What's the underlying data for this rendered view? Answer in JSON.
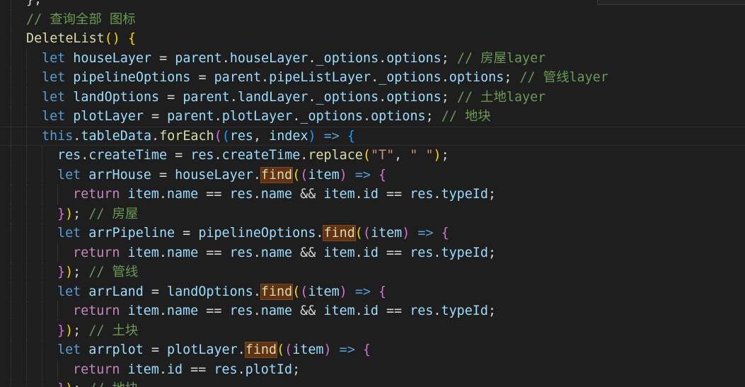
{
  "editor": {
    "language": "javascript",
    "theme": "dark",
    "lines": [
      {
        "indent": 1,
        "tokens": [
          [
            "pun",
            "};"
          ]
        ]
      },
      {
        "indent": 1,
        "tokens": [
          [
            "cm",
            "// 查询全部 图标"
          ]
        ]
      },
      {
        "indent": 1,
        "tokens": [
          [
            "fn",
            "DeleteList"
          ],
          [
            "b1",
            "()"
          ],
          [
            "pun",
            " "
          ],
          [
            "b1",
            "{"
          ]
        ]
      },
      {
        "indent": 2,
        "tokens": [
          [
            "kw",
            "let"
          ],
          [
            "pun",
            " "
          ],
          [
            "var",
            "houseLayer"
          ],
          [
            "pun",
            " = "
          ],
          [
            "var",
            "parent"
          ],
          [
            "pun",
            "."
          ],
          [
            "var",
            "houseLayer"
          ],
          [
            "pun",
            "."
          ],
          [
            "var",
            "_options"
          ],
          [
            "pun",
            "."
          ],
          [
            "var",
            "options"
          ],
          [
            "pun",
            "; "
          ],
          [
            "cm",
            "// 房屋layer"
          ]
        ]
      },
      {
        "indent": 2,
        "tokens": [
          [
            "kw",
            "let"
          ],
          [
            "pun",
            " "
          ],
          [
            "var",
            "pipelineOptions"
          ],
          [
            "pun",
            " = "
          ],
          [
            "var",
            "parent"
          ],
          [
            "pun",
            "."
          ],
          [
            "var",
            "pipeListLayer"
          ],
          [
            "pun",
            "."
          ],
          [
            "var",
            "_options"
          ],
          [
            "pun",
            "."
          ],
          [
            "var",
            "options"
          ],
          [
            "pun",
            "; "
          ],
          [
            "cm",
            "// 管线layer"
          ]
        ]
      },
      {
        "indent": 2,
        "tokens": [
          [
            "kw",
            "let"
          ],
          [
            "pun",
            " "
          ],
          [
            "var",
            "landOptions"
          ],
          [
            "pun",
            " = "
          ],
          [
            "var",
            "parent"
          ],
          [
            "pun",
            "."
          ],
          [
            "var",
            "landLayer"
          ],
          [
            "pun",
            "."
          ],
          [
            "var",
            "_options"
          ],
          [
            "pun",
            "."
          ],
          [
            "var",
            "options"
          ],
          [
            "pun",
            "; "
          ],
          [
            "cm",
            "// 土地layer"
          ]
        ]
      },
      {
        "indent": 2,
        "tokens": [
          [
            "kw",
            "let"
          ],
          [
            "pun",
            " "
          ],
          [
            "var",
            "plotLayer"
          ],
          [
            "pun",
            " = "
          ],
          [
            "var",
            "parent"
          ],
          [
            "pun",
            "."
          ],
          [
            "var",
            "plotLayer"
          ],
          [
            "pun",
            "."
          ],
          [
            "var",
            "_options"
          ],
          [
            "pun",
            "."
          ],
          [
            "var",
            "options"
          ],
          [
            "pun",
            "; "
          ],
          [
            "cm",
            "// 地块"
          ]
        ]
      },
      {
        "indent": 2,
        "active": true,
        "tokens": [
          [
            "kw",
            "this"
          ],
          [
            "pun",
            "."
          ],
          [
            "var",
            "tableData"
          ],
          [
            "pun",
            "."
          ],
          [
            "fn",
            "forEach"
          ],
          [
            "b2",
            "("
          ],
          [
            "b3",
            "("
          ],
          [
            "var",
            "res"
          ],
          [
            "pun",
            ", "
          ],
          [
            "var",
            "index"
          ],
          [
            "b3",
            ")"
          ],
          [
            "pun",
            " "
          ],
          [
            "kw",
            "=>"
          ],
          [
            "pun",
            " "
          ],
          [
            "b3",
            "{"
          ]
        ]
      },
      {
        "indent": 3,
        "tokens": [
          [
            "var",
            "res"
          ],
          [
            "pun",
            "."
          ],
          [
            "var",
            "createTime"
          ],
          [
            "pun",
            " = "
          ],
          [
            "var",
            "res"
          ],
          [
            "pun",
            "."
          ],
          [
            "var",
            "createTime"
          ],
          [
            "pun",
            "."
          ],
          [
            "fn",
            "replace"
          ],
          [
            "b1",
            "("
          ],
          [
            "str",
            "\"T\""
          ],
          [
            "pun",
            ", "
          ],
          [
            "str",
            "\" \""
          ],
          [
            "b1",
            ")"
          ],
          [
            "pun",
            ";"
          ]
        ]
      },
      {
        "indent": 3,
        "tokens": [
          [
            "kw",
            "let"
          ],
          [
            "pun",
            " "
          ],
          [
            "var",
            "arrHouse"
          ],
          [
            "pun",
            " = "
          ],
          [
            "var",
            "houseLayer"
          ],
          [
            "pun",
            "."
          ],
          [
            "fnh",
            "find"
          ],
          [
            "b1",
            "("
          ],
          [
            "b2",
            "("
          ],
          [
            "var",
            "item"
          ],
          [
            "b2",
            ")"
          ],
          [
            "pun",
            " "
          ],
          [
            "kw",
            "=>"
          ],
          [
            "pun",
            " "
          ],
          [
            "b2",
            "{"
          ]
        ]
      },
      {
        "indent": 4,
        "tokens": [
          [
            "ctl",
            "return"
          ],
          [
            "pun",
            " "
          ],
          [
            "var",
            "item"
          ],
          [
            "pun",
            "."
          ],
          [
            "var",
            "name"
          ],
          [
            "pun",
            " == "
          ],
          [
            "var",
            "res"
          ],
          [
            "pun",
            "."
          ],
          [
            "var",
            "name"
          ],
          [
            "pun",
            " && "
          ],
          [
            "var",
            "item"
          ],
          [
            "pun",
            "."
          ],
          [
            "var",
            "id"
          ],
          [
            "pun",
            " == "
          ],
          [
            "var",
            "res"
          ],
          [
            "pun",
            "."
          ],
          [
            "var",
            "typeId"
          ],
          [
            "pun",
            ";"
          ]
        ]
      },
      {
        "indent": 3,
        "tokens": [
          [
            "b2",
            "}"
          ],
          [
            "b1",
            ")"
          ],
          [
            "pun",
            "; "
          ],
          [
            "cm",
            "// 房屋"
          ]
        ]
      },
      {
        "indent": 3,
        "tokens": [
          [
            "kw",
            "let"
          ],
          [
            "pun",
            " "
          ],
          [
            "var",
            "arrPipeline"
          ],
          [
            "pun",
            " = "
          ],
          [
            "var",
            "pipelineOptions"
          ],
          [
            "pun",
            "."
          ],
          [
            "fnh",
            "find"
          ],
          [
            "b1",
            "("
          ],
          [
            "b2",
            "("
          ],
          [
            "var",
            "item"
          ],
          [
            "b2",
            ")"
          ],
          [
            "pun",
            " "
          ],
          [
            "kw",
            "=>"
          ],
          [
            "pun",
            " "
          ],
          [
            "b2",
            "{"
          ]
        ]
      },
      {
        "indent": 4,
        "tokens": [
          [
            "ctl",
            "return"
          ],
          [
            "pun",
            " "
          ],
          [
            "var",
            "item"
          ],
          [
            "pun",
            "."
          ],
          [
            "var",
            "name"
          ],
          [
            "pun",
            " == "
          ],
          [
            "var",
            "res"
          ],
          [
            "pun",
            "."
          ],
          [
            "var",
            "name"
          ],
          [
            "pun",
            " && "
          ],
          [
            "var",
            "item"
          ],
          [
            "pun",
            "."
          ],
          [
            "var",
            "id"
          ],
          [
            "pun",
            " == "
          ],
          [
            "var",
            "res"
          ],
          [
            "pun",
            "."
          ],
          [
            "var",
            "typeId"
          ],
          [
            "pun",
            ";"
          ]
        ]
      },
      {
        "indent": 3,
        "tokens": [
          [
            "b2",
            "}"
          ],
          [
            "b1",
            ")"
          ],
          [
            "pun",
            "; "
          ],
          [
            "cm",
            "// 管线"
          ]
        ]
      },
      {
        "indent": 3,
        "tokens": [
          [
            "kw",
            "let"
          ],
          [
            "pun",
            " "
          ],
          [
            "var",
            "arrLand"
          ],
          [
            "pun",
            " = "
          ],
          [
            "var",
            "landOptions"
          ],
          [
            "pun",
            "."
          ],
          [
            "fnh",
            "find"
          ],
          [
            "b1",
            "("
          ],
          [
            "b2",
            "("
          ],
          [
            "var",
            "item"
          ],
          [
            "b2",
            ")"
          ],
          [
            "pun",
            " "
          ],
          [
            "kw",
            "=>"
          ],
          [
            "pun",
            " "
          ],
          [
            "b2",
            "{"
          ]
        ]
      },
      {
        "indent": 4,
        "tokens": [
          [
            "ctl",
            "return"
          ],
          [
            "pun",
            " "
          ],
          [
            "var",
            "item"
          ],
          [
            "pun",
            "."
          ],
          [
            "var",
            "name"
          ],
          [
            "pun",
            " == "
          ],
          [
            "var",
            "res"
          ],
          [
            "pun",
            "."
          ],
          [
            "var",
            "name"
          ],
          [
            "pun",
            " && "
          ],
          [
            "var",
            "item"
          ],
          [
            "pun",
            "."
          ],
          [
            "var",
            "id"
          ],
          [
            "pun",
            " == "
          ],
          [
            "var",
            "res"
          ],
          [
            "pun",
            "."
          ],
          [
            "var",
            "typeId"
          ],
          [
            "pun",
            ";"
          ]
        ]
      },
      {
        "indent": 3,
        "tokens": [
          [
            "b2",
            "}"
          ],
          [
            "b1",
            ")"
          ],
          [
            "pun",
            "; "
          ],
          [
            "cm",
            "// 土块"
          ]
        ]
      },
      {
        "indent": 3,
        "tokens": [
          [
            "kw",
            "let"
          ],
          [
            "pun",
            " "
          ],
          [
            "var",
            "arrplot"
          ],
          [
            "pun",
            " = "
          ],
          [
            "var",
            "plotLayer"
          ],
          [
            "pun",
            "."
          ],
          [
            "fnh",
            "find"
          ],
          [
            "b1",
            "("
          ],
          [
            "b2",
            "("
          ],
          [
            "var",
            "item"
          ],
          [
            "b2",
            ")"
          ],
          [
            "pun",
            " "
          ],
          [
            "kw",
            "=>"
          ],
          [
            "pun",
            " "
          ],
          [
            "b2",
            "{"
          ]
        ]
      },
      {
        "indent": 4,
        "tokens": [
          [
            "ctl",
            "return"
          ],
          [
            "pun",
            " "
          ],
          [
            "var",
            "item"
          ],
          [
            "pun",
            "."
          ],
          [
            "var",
            "id"
          ],
          [
            "pun",
            " == "
          ],
          [
            "var",
            "res"
          ],
          [
            "pun",
            "."
          ],
          [
            "var",
            "plotId"
          ],
          [
            "pun",
            ";"
          ]
        ]
      },
      {
        "indent": 3,
        "tokens": [
          [
            "b2",
            "}"
          ],
          [
            "b1",
            ")"
          ],
          [
            "pun",
            "; "
          ],
          [
            "cm",
            "// 地块"
          ]
        ]
      }
    ]
  }
}
